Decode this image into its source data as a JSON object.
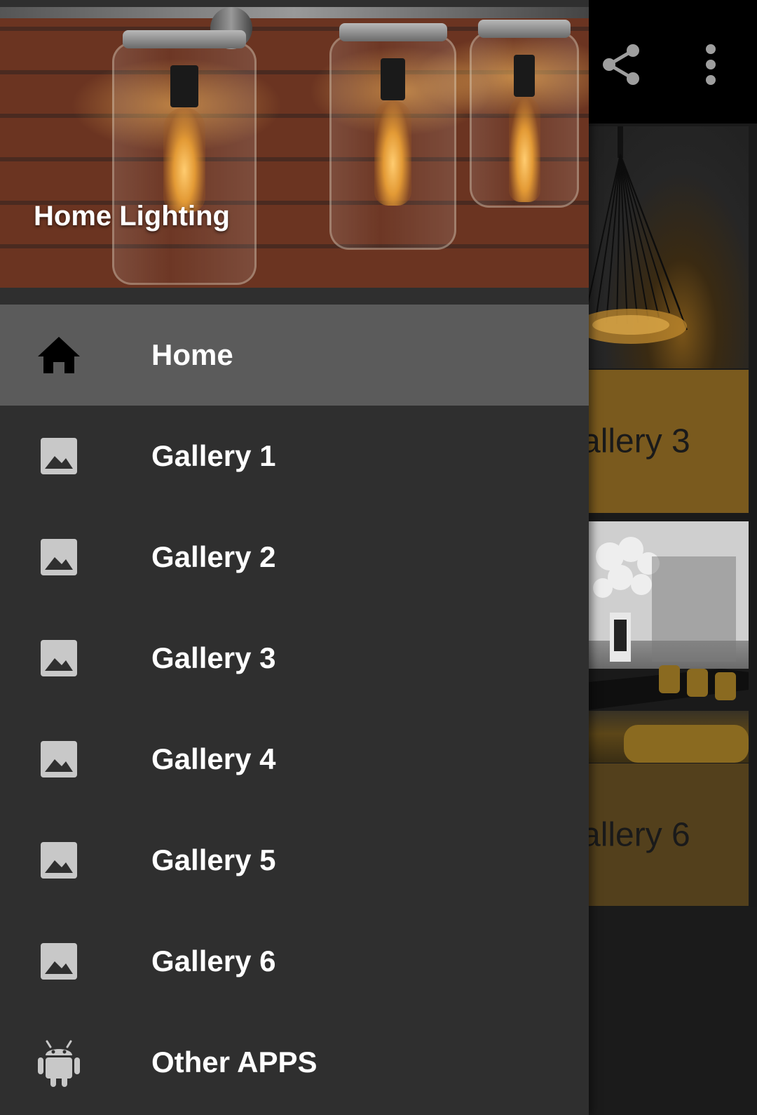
{
  "drawer": {
    "header_title": "Home Lighting",
    "items": [
      {
        "label": "Home",
        "icon": "home-icon",
        "active": true
      },
      {
        "label": "Gallery 1",
        "icon": "image-icon"
      },
      {
        "label": "Gallery 2",
        "icon": "image-icon"
      },
      {
        "label": "Gallery 3",
        "icon": "image-icon"
      },
      {
        "label": "Gallery 4",
        "icon": "image-icon"
      },
      {
        "label": "Gallery 5",
        "icon": "image-icon"
      },
      {
        "label": "Gallery 6",
        "icon": "image-icon"
      },
      {
        "label": "Other APPS",
        "icon": "android-icon"
      }
    ]
  },
  "toolbar": {
    "share_icon": "share-icon",
    "more_icon": "more-vert-icon"
  },
  "background_tiles": {
    "tile1_label": "allery 3",
    "tile2_label": "allery 6"
  },
  "colors": {
    "drawer_bg": "#2f2f2f",
    "active_item_bg": "#5b5b5b",
    "gold_tile": "#7a5a1e",
    "appbar_bg": "#000000"
  }
}
